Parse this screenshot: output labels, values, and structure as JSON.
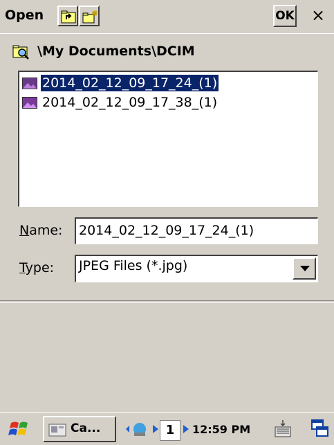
{
  "titlebar": {
    "title": "Open",
    "up_folder_icon": "up-folder-icon",
    "new_folder_icon": "new-folder-icon",
    "ok_label": "OK",
    "close_label": "×"
  },
  "location": {
    "path": "\\My Documents\\DCIM",
    "icon": "folder-search-icon"
  },
  "files": [
    {
      "name": "2014_02_12_09_17_24_(1)",
      "selected": true,
      "icon": "image-file-icon"
    },
    {
      "name": "2014_02_12_09_17_38_(1)",
      "selected": false,
      "icon": "image-file-icon"
    }
  ],
  "form": {
    "name_label_u": "N",
    "name_label_rest": "ame:",
    "name_value": "2014_02_12_09_17_24_(1)",
    "type_label_u": "T",
    "type_label_rest": "ype:",
    "type_value": "JPEG Files (*.jpg)"
  },
  "taskbar": {
    "start_icon": "windows-flag-icon",
    "app_label": "Ca...",
    "input_number": "1",
    "time": "12:59 PM",
    "keyboard_icon": "keyboard-icon",
    "desktop_icon": "switch-windows-icon"
  },
  "colors": {
    "selection": "#0a246a",
    "chrome": "#d4d0c8"
  }
}
